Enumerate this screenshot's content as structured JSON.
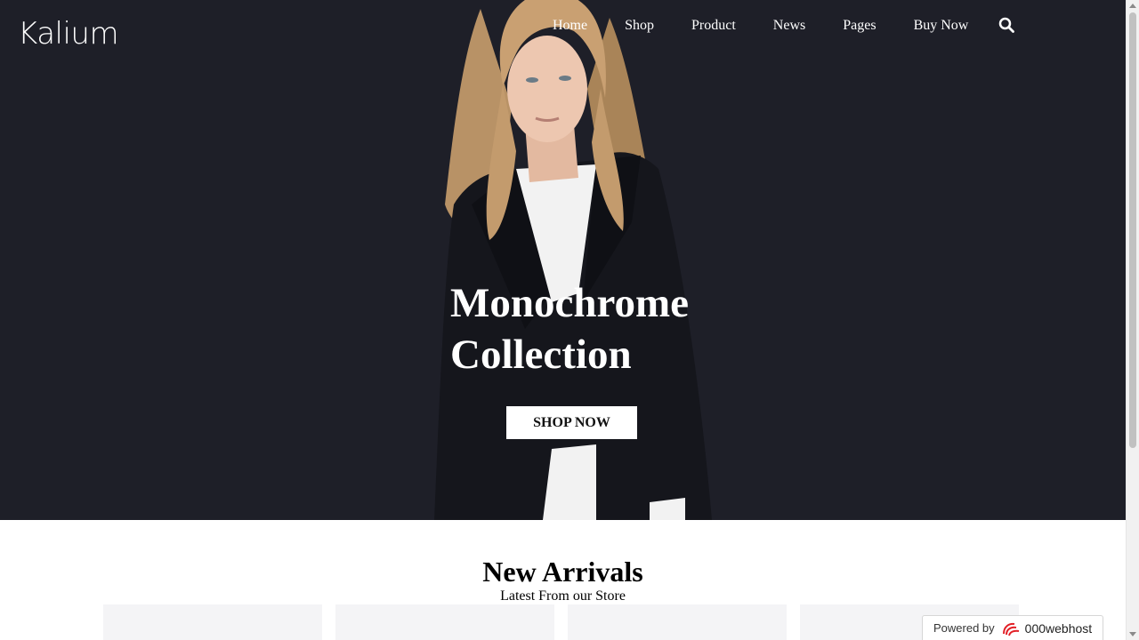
{
  "site": {
    "logo_text": "Kalium"
  },
  "nav": {
    "items": [
      {
        "label": "Home"
      },
      {
        "label": "Shop"
      },
      {
        "label": "Product"
      },
      {
        "label": "News"
      },
      {
        "label": "Pages"
      },
      {
        "label": "Buy Now"
      }
    ],
    "search_icon": "search-icon"
  },
  "hero": {
    "title": "Monochrome\nCollection",
    "cta_label": "SHOP NOW",
    "background_color": "#1e1f28"
  },
  "new_arrivals": {
    "title": "New Arrivals",
    "subtitle": "Latest From our Store"
  },
  "badge": {
    "powered_by": "Powered by",
    "brand": "000webhost",
    "icon": "000webhost-swirl-icon"
  }
}
